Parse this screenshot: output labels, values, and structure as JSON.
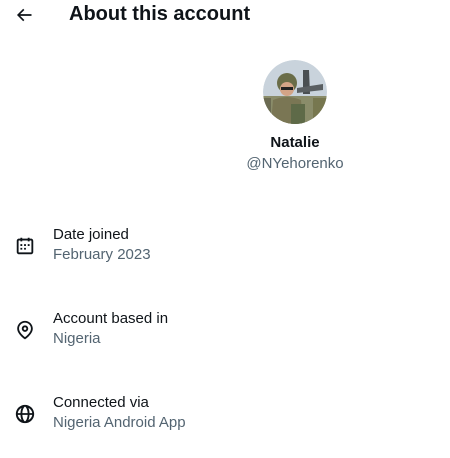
{
  "header": {
    "title": "About this account",
    "back_icon": "arrow-left-icon"
  },
  "profile": {
    "name": "Natalie",
    "handle": "@NYehorenko",
    "avatar_icon": "profile-photo-avatar"
  },
  "details": [
    {
      "icon": "calendar-icon",
      "label": "Date joined",
      "value": "February 2023"
    },
    {
      "icon": "location-pin-icon",
      "label": "Account based in",
      "value": "Nigeria"
    },
    {
      "icon": "globe-icon",
      "label": "Connected via",
      "value": "Nigeria Android App"
    }
  ],
  "colors": {
    "text_primary": "#0f1419",
    "text_secondary": "#536471",
    "background": "#ffffff"
  }
}
